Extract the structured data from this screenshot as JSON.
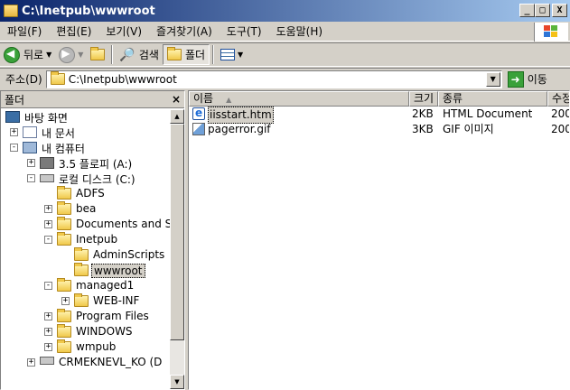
{
  "window": {
    "title": "C:\\Inetpub\\wwwroot",
    "btn_min": "_",
    "btn_max": "□",
    "btn_close": "X"
  },
  "menu": [
    "파일(F)",
    "편집(E)",
    "보기(V)",
    "즐겨찾기(A)",
    "도구(T)",
    "도움말(H)"
  ],
  "toolbar": {
    "back_label": "뒤로",
    "search_label": "검색",
    "folders_label": "폴더"
  },
  "address": {
    "label": "주소(D)",
    "value": "C:\\Inetpub\\wwwroot",
    "go_label": "이동"
  },
  "folder_pane": {
    "title": "폴더",
    "close": "×",
    "tree": [
      {
        "label": "바탕 화면",
        "level": 0,
        "icon": "desktop-icon",
        "expander": ""
      },
      {
        "label": "내 문서",
        "level": 1,
        "icon": "my-documents-icon",
        "expander": "+"
      },
      {
        "label": "내 컴퓨터",
        "level": 1,
        "icon": "my-computer-icon",
        "expander": "−"
      },
      {
        "label": "3.5 플로피 (A:)",
        "level": 2,
        "icon": "floppy-icon",
        "expander": "+"
      },
      {
        "label": "로컬 디스크 (C:)",
        "level": 2,
        "icon": "drive-icon",
        "expander": "−"
      },
      {
        "label": "ADFS",
        "level": 3,
        "icon": "folder-icon",
        "expander": ""
      },
      {
        "label": "bea",
        "level": 3,
        "icon": "folder-icon",
        "expander": "+"
      },
      {
        "label": "Documents and S",
        "level": 3,
        "icon": "folder-icon",
        "expander": "+"
      },
      {
        "label": "Inetpub",
        "level": 3,
        "icon": "folder-icon",
        "expander": "−"
      },
      {
        "label": "AdminScripts",
        "level": 4,
        "icon": "folder-icon",
        "expander": ""
      },
      {
        "label": "wwwroot",
        "level": 4,
        "icon": "folder-icon",
        "expander": "",
        "selected": true
      },
      {
        "label": "managed1",
        "level": 3,
        "icon": "folder-icon",
        "expander": "−"
      },
      {
        "label": "WEB-INF",
        "level": 4,
        "icon": "folder-icon",
        "expander": "+"
      },
      {
        "label": "Program Files",
        "level": 3,
        "icon": "folder-icon",
        "expander": "+"
      },
      {
        "label": "WINDOWS",
        "level": 3,
        "icon": "folder-icon",
        "expander": "+"
      },
      {
        "label": "wmpub",
        "level": 3,
        "icon": "folder-icon",
        "expander": "+"
      },
      {
        "label": "CRMEKNEVL_KO (D",
        "level": 2,
        "icon": "network-drive-icon",
        "expander": "+"
      }
    ]
  },
  "file_list": {
    "columns": [
      "이름",
      "크기",
      "종류",
      "수정"
    ],
    "rows": [
      {
        "name": "iisstart.htm",
        "size": "2KB",
        "type": "HTML Document",
        "modified": "200",
        "icon": "ie-document-icon",
        "selected": true
      },
      {
        "name": "pagerror.gif",
        "size": "3KB",
        "type": "GIF 이미지",
        "modified": "200",
        "icon": "gif-image-icon"
      }
    ]
  },
  "colors": {
    "title_start": "#0a246a",
    "title_end": "#a6caf0",
    "chrome": "#d4d0c8"
  }
}
